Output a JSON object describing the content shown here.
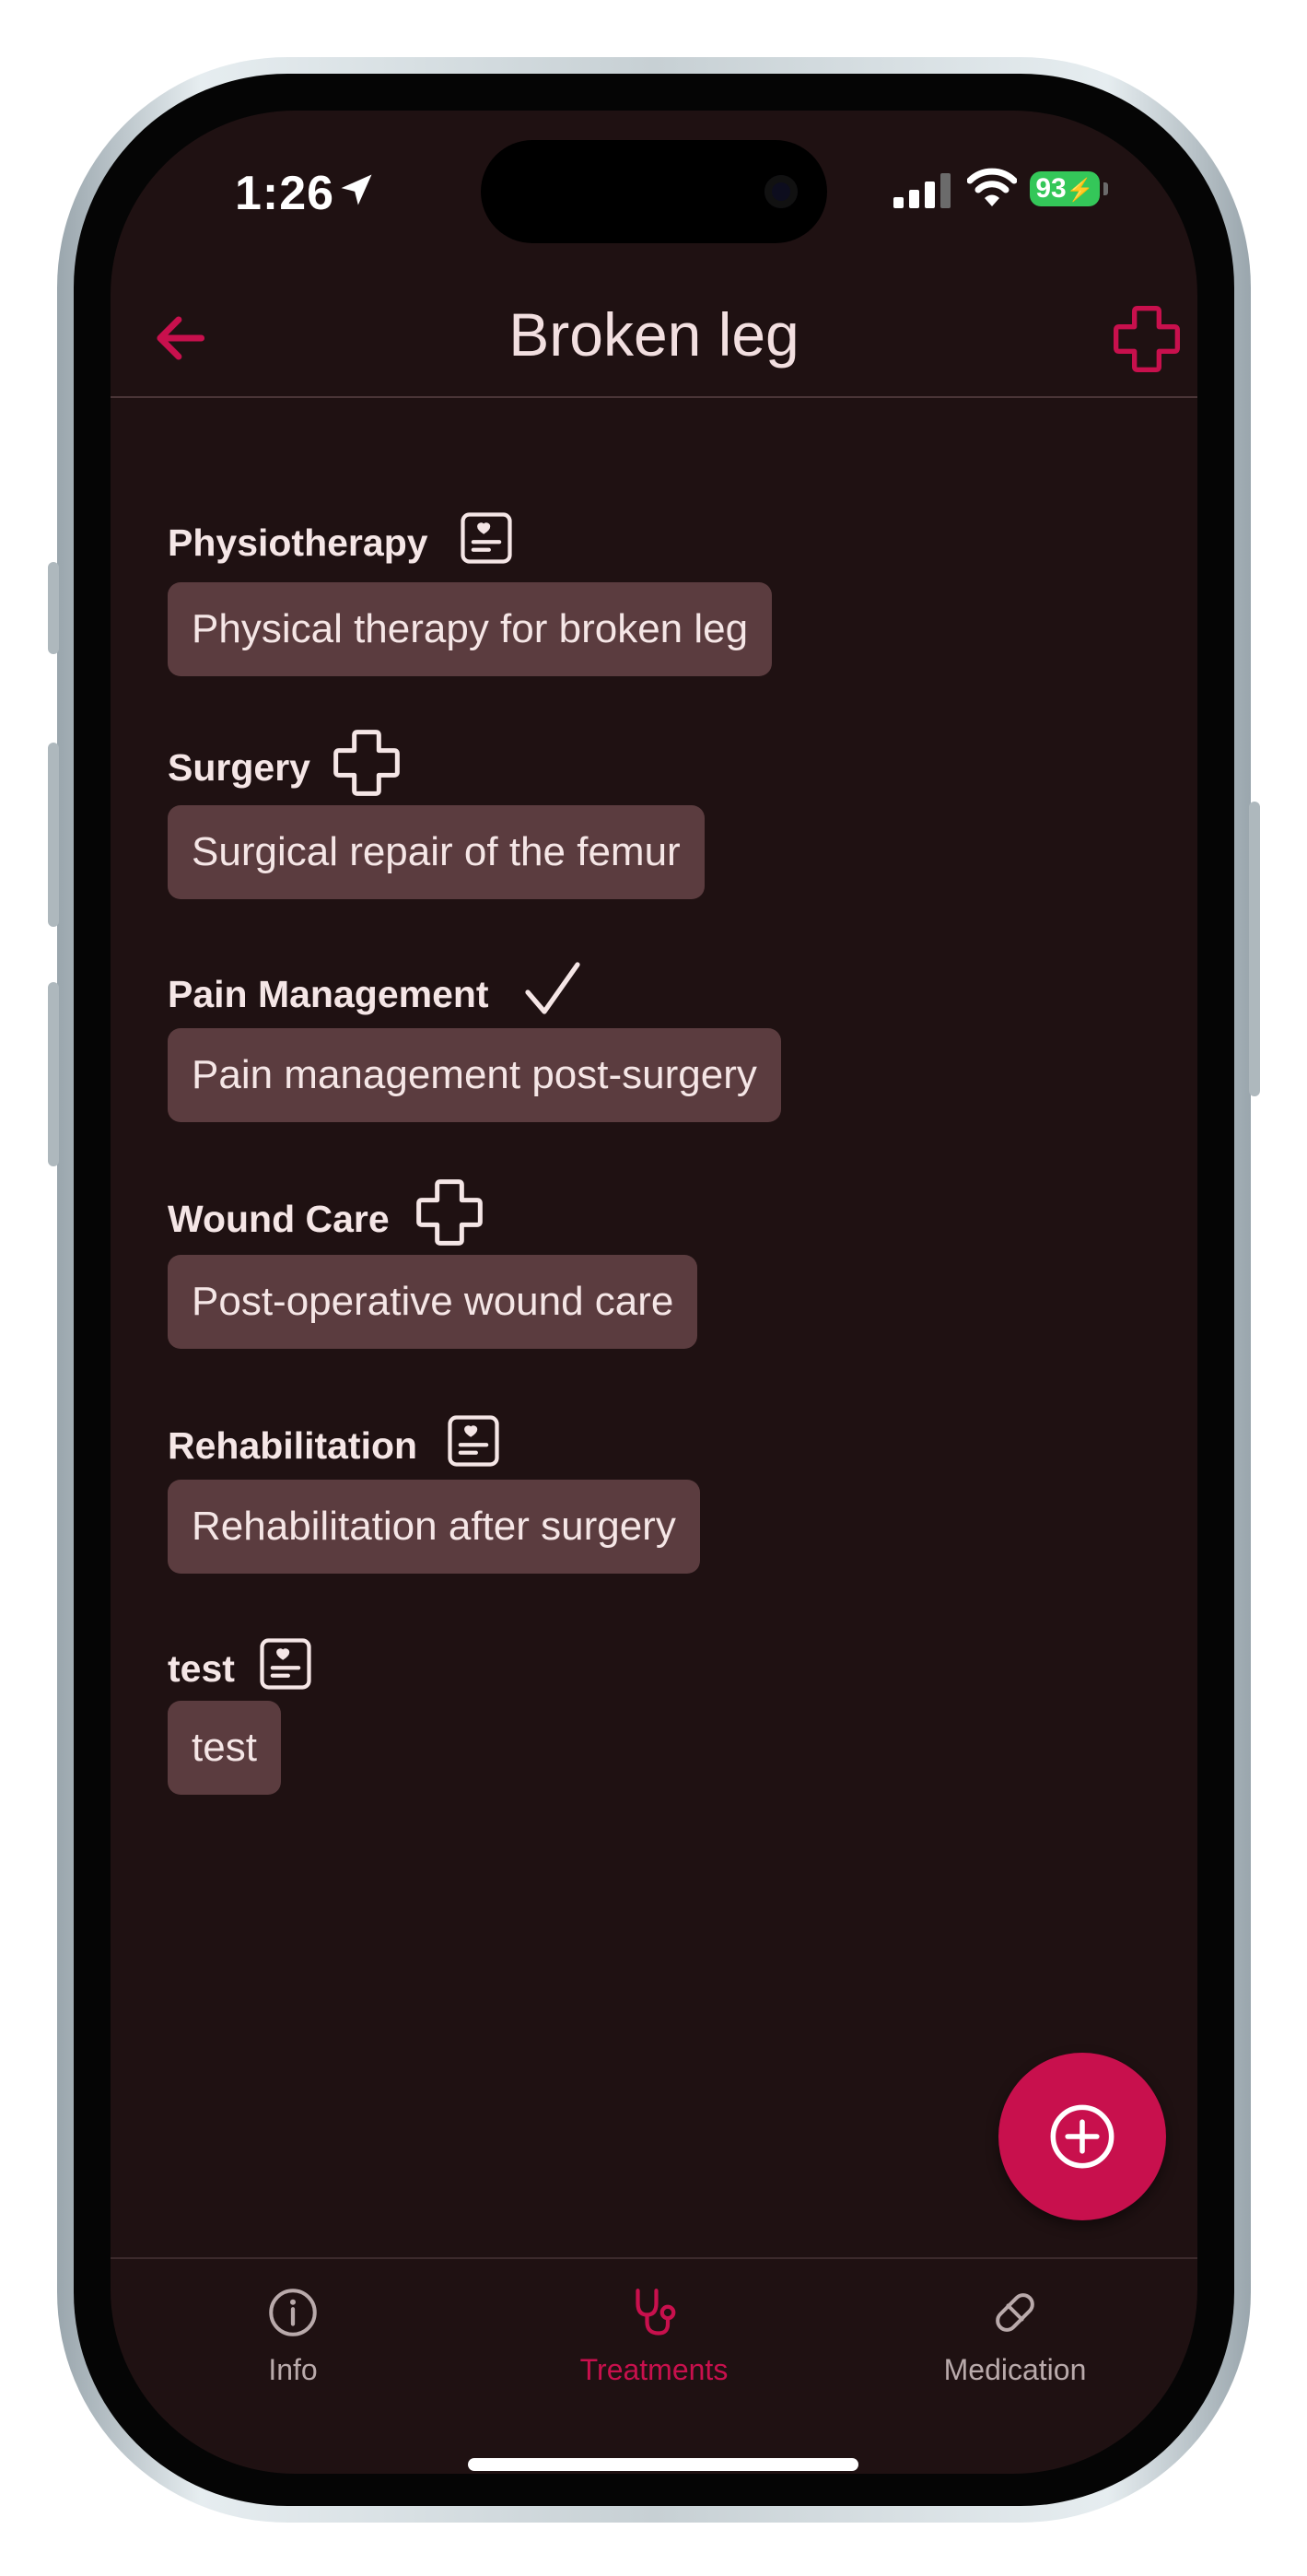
{
  "status_bar": {
    "time": "1:26",
    "battery": "93"
  },
  "app_bar": {
    "title": "Broken leg"
  },
  "treatments": [
    {
      "name": "Physiotherapy",
      "icon": "medical-record-icon",
      "description": "Physical therapy for broken leg"
    },
    {
      "name": "Surgery",
      "icon": "medical-cross-icon",
      "description": "Surgical repair of the femur"
    },
    {
      "name": "Pain Management",
      "icon": "checkmark-icon",
      "description": "Pain management post-surgery"
    },
    {
      "name": "Wound Care",
      "icon": "medical-cross-icon",
      "description": "Post-operative wound care"
    },
    {
      "name": "Rehabilitation",
      "icon": "medical-record-icon",
      "description": "Rehabilitation after surgery"
    },
    {
      "name": "test",
      "icon": "medical-record-icon",
      "description": "test"
    }
  ],
  "bottom_nav": {
    "items": [
      {
        "label": "Info",
        "icon": "info-icon",
        "active": false
      },
      {
        "label": "Treatments",
        "icon": "stethoscope-icon",
        "active": true
      },
      {
        "label": "Medication",
        "icon": "pill-icon",
        "active": false
      }
    ]
  },
  "colors": {
    "accent": "#c8104d",
    "background": "#1f1112",
    "chip": "#5b3c3f",
    "text": "#f2dfe0",
    "nav_inactive": "#b9aaab"
  }
}
